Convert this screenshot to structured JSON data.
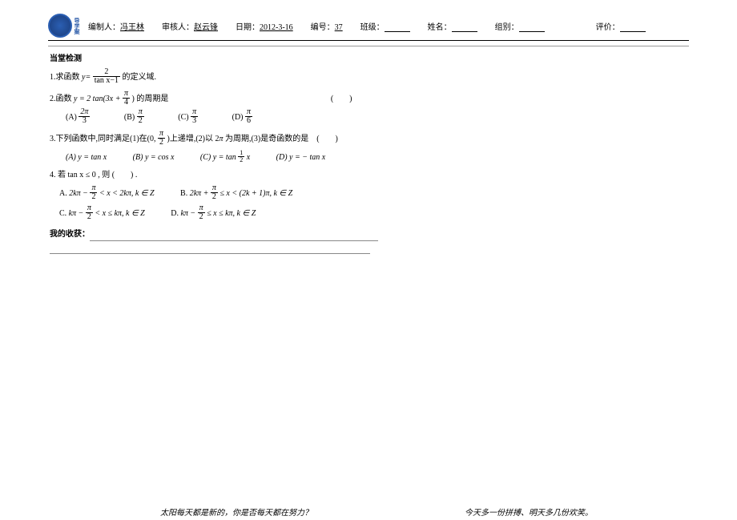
{
  "header": {
    "compiler_label": "编制人：",
    "compiler_value": "冯王林",
    "reviewer_label": "审核人：",
    "reviewer_value": "赵云锋",
    "date_label": "日期：",
    "date_value": "2012-3-16",
    "serial_label": "编号：",
    "serial_value": "37",
    "class_label": "班级：",
    "name_label": "姓名：",
    "group_label": "组别：",
    "eval_label": "评价：",
    "logo_side": "导学案"
  },
  "section": {
    "title": "当堂检测"
  },
  "q1": {
    "prefix": "1.求函数 ",
    "y_eq": "y=",
    "num": "2",
    "den_a": "tan x",
    "den_b": "−1",
    "suffix": " 的定义域."
  },
  "q2": {
    "text_a": "2.函数 ",
    "expr_a": "y = 2 tan(3x + ",
    "frac_num": "π",
    "frac_den": "4",
    "expr_b": ") 的周期是",
    "paren": "(　　)",
    "opts": {
      "A_label": "(A)",
      "A_num": "2π",
      "A_den": "3",
      "B_label": "(B)",
      "B_num": "π",
      "B_den": "2",
      "C_label": "(C)",
      "C_num": "π",
      "C_den": "3",
      "D_label": "(D)",
      "D_num": "π",
      "D_den": "6"
    }
  },
  "q3": {
    "text_a": "3.下列函数中,同时满足(1)在(0, ",
    "frac_num": "π",
    "frac_den": "2",
    "text_b": " )上递增,(2)以 2",
    "pi": "π",
    "text_c": " 为周期,(3)是奇函数的是　(　　)",
    "opts": {
      "A": "(A) y = tan x",
      "B": "(B) y = cos x",
      "C_prefix": "(C) y = tan ",
      "C_num": "1",
      "C_den": "2",
      "C_suffix": " x",
      "D": "(D) y = − tan x"
    }
  },
  "q4": {
    "text": "4. 若 tan x ≤ 0 , 则 (　　) .",
    "A_label": "A.",
    "A_left": "2kπ − ",
    "A_num": "π",
    "A_den": "2",
    "A_right": " < x < 2kπ, k ∈ Z",
    "B_label": "B.",
    "B_left": "2kπ + ",
    "B_num": "π",
    "B_den": "2",
    "B_right": " ≤ x < (2k + 1)π, k ∈ Z",
    "C_label": "C.",
    "C_left": "kπ − ",
    "C_num": "π",
    "C_den": "2",
    "C_right": " < x ≤ kπ, k ∈ Z",
    "D_label": "D.",
    "D_left": "kπ − ",
    "D_num": "π",
    "D_den": "2",
    "D_right": " ≤ x ≤ kπ, k ∈ Z"
  },
  "collection": {
    "label": "我的收获："
  },
  "footer": {
    "left": "太阳每天都是新的，你是否每天都在努力？",
    "right": "今天多一份拼搏、明天多几份欢笑。"
  }
}
